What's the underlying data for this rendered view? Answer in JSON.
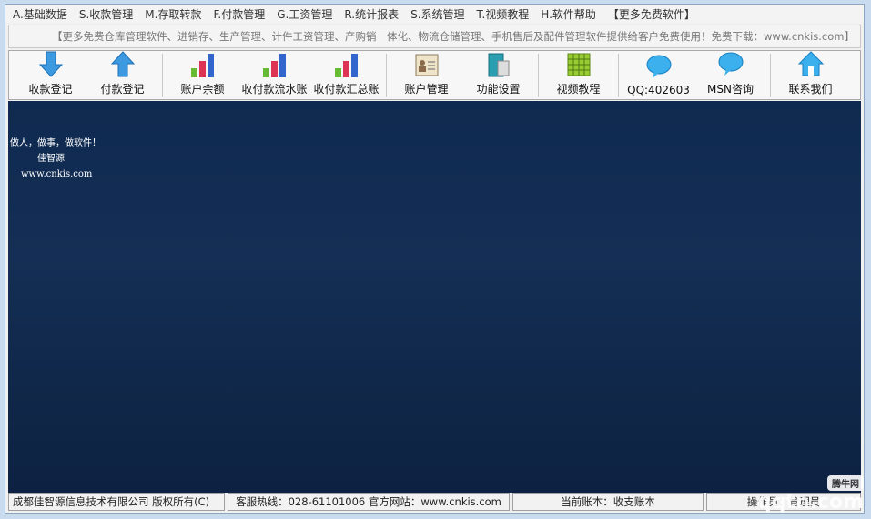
{
  "menu": [
    "A.基础数据",
    "S.收款管理",
    "M.存取转款",
    "F.付款管理",
    "G.工资管理",
    "R.统计报表",
    "S.系统管理",
    "T.视频教程",
    "H.软件帮助",
    "【更多免费软件】"
  ],
  "banner": "【更多免费仓库管理软件、进销存、生产管理、计件工资管理、产购销一体化、物流仓储管理、手机售后及配件管理软件提供给客户免费使用！免费下载：www.cnkis.com】",
  "toolbar": [
    {
      "label": "收款登记",
      "icon": "arrow-down-icon"
    },
    {
      "label": "付款登记",
      "icon": "arrow-up-icon"
    },
    {
      "label": "账户余额",
      "icon": "bar-chart-icon"
    },
    {
      "label": "收付款流水账",
      "icon": "bar-chart-icon"
    },
    {
      "label": "收付款汇总账",
      "icon": "bar-chart-icon"
    },
    {
      "label": "账户管理",
      "icon": "contact-card-icon"
    },
    {
      "label": "功能设置",
      "icon": "book-icon"
    },
    {
      "label": "视频教程",
      "icon": "grid-icon"
    },
    {
      "label": "QQ:402603",
      "icon": "speech-bubble-icon"
    },
    {
      "label": "MSN咨询",
      "icon": "speech-bubble-icon"
    },
    {
      "label": "联系我们",
      "icon": "home-icon"
    }
  ],
  "slogan": [
    "做人，做事，做软件！",
    "佳智源",
    "www.cnkis.com"
  ],
  "status": {
    "company": "成都佳智源信息技术有限公司 版权所有(C)",
    "contact": "客服热线：028-61101006 官方网站：www.cnkis.com",
    "account": "当前账本：收支账本",
    "operator": "操作员：管理员"
  },
  "watermark": {
    "brand": "腾牛网",
    "text": "qqtn.com"
  },
  "colors": {
    "background": "#12294d"
  }
}
